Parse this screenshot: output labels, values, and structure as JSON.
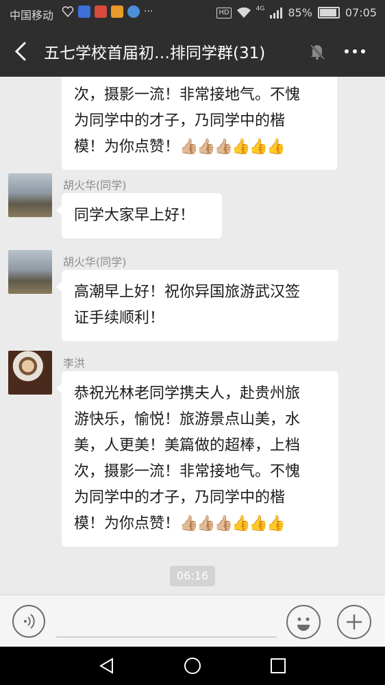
{
  "status_bar": {
    "carrier": "中国移动",
    "battery": "85%",
    "time": "07:05",
    "hd_label": "HD",
    "network_label": "4G",
    "battery_level": 0.85
  },
  "header": {
    "title": "五七学校首届初…排同学群(31)"
  },
  "messages": [
    {
      "sender": "",
      "lines": [
        "次，摄影一流！非常接地气。不愧",
        "为同学中的才子，乃同学中的楷",
        "模！为你点赞！"
      ],
      "thumbs": "👍🏼👍🏼👍🏼👍👍👍"
    },
    {
      "sender": "胡火华(同学)",
      "lines": [
        "同学大家早上好！"
      ]
    },
    {
      "sender": "胡火华(同学)",
      "lines": [
        "高潮早上好！祝你异国旅游武汉签",
        "证手续顺利！"
      ]
    },
    {
      "sender": "李洪",
      "lines": [
        "恭祝光林老同学携夫人，赴贵州旅",
        "游快乐，愉悦！旅游景点山美，水",
        "美，人更美！美篇做的超棒，上档",
        "次，摄影一流！非常接地气。不愧",
        "为同学中的才子，乃同学中的楷",
        "模！为你点赞！"
      ],
      "thumbs": "👍🏼👍🏼👍🏼👍👍👍"
    }
  ],
  "timestamp": "06:16",
  "colors": {
    "header_bg": "#2e2e2e",
    "chat_bg": "#ebebeb",
    "bubble_bg": "#ffffff"
  }
}
